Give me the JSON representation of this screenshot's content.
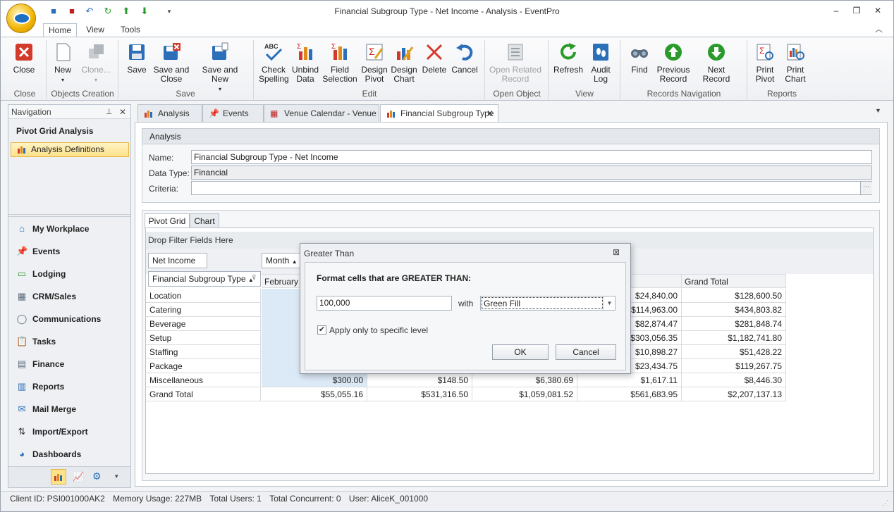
{
  "window": {
    "title": "Financial Subgroup Type - Net Income - Analysis - EventPro",
    "minimize_icon": "minimize-icon",
    "restore_icon": "restore-icon",
    "close_icon": "close-icon"
  },
  "ribbon_tabs": [
    "Home",
    "View",
    "Tools"
  ],
  "ribbon": {
    "close": "Close",
    "new": "New",
    "clone": "Clone...",
    "save": "Save",
    "save_close": "Save and\nClose",
    "save_new": "Save and New",
    "check_spelling": "Check\nSpelling",
    "unbind_data": "Unbind\nData",
    "field_selection": "Field\nSelection",
    "design_pivot": "Design\nPivot",
    "design_chart": "Design\nChart",
    "delete": "Delete",
    "cancel": "Cancel",
    "open_related_record": "Open Related\nRecord",
    "refresh": "Refresh",
    "audit_log": "Audit\nLog",
    "find": "Find",
    "previous_record": "Previous\nRecord",
    "next_record": "Next Record",
    "print_pivot": "Print\nPivot",
    "print_chart": "Print\nChart",
    "groups": {
      "close": "Close",
      "objects_creation": "Objects Creation",
      "save": "Save",
      "edit": "Edit",
      "open_object": "Open Object",
      "view": "View",
      "records_navigation": "Records Navigation",
      "reports": "Reports"
    }
  },
  "navigation": {
    "header": "Navigation",
    "title": "Pivot Grid Analysis",
    "selected_item": "Analysis Definitions",
    "items": [
      {
        "label": "My Workplace",
        "icon": "home-icon"
      },
      {
        "label": "Events",
        "icon": "pin-icon"
      },
      {
        "label": "Lodging",
        "icon": "bed-icon"
      },
      {
        "label": "CRM/Sales",
        "icon": "crm-icon"
      },
      {
        "label": "Communications",
        "icon": "speech-bubble-icon"
      },
      {
        "label": "Tasks",
        "icon": "clipboard-icon"
      },
      {
        "label": "Finance",
        "icon": "ledger-icon"
      },
      {
        "label": "Reports",
        "icon": "report-icon"
      },
      {
        "label": "Mail Merge",
        "icon": "mail-merge-icon"
      },
      {
        "label": "Import/Export",
        "icon": "import-export-icon"
      },
      {
        "label": "Dashboards",
        "icon": "dashboard-icon"
      }
    ]
  },
  "doc_tabs": [
    {
      "label": "Analysis",
      "icon": "pivot-icon"
    },
    {
      "label": "Events",
      "icon": "pin-icon"
    },
    {
      "label": "Venue Calendar - Venue",
      "icon": "calendar-icon"
    },
    {
      "label": "Financial Subgroup Type",
      "icon": "pivot-icon"
    }
  ],
  "analysis": {
    "header": "Analysis",
    "name_label": "Name:",
    "name_value": "Financial Subgroup Type - Net Income",
    "datatype_label": "Data Type:",
    "datatype_value": "Financial",
    "criteria_label": "Criteria:",
    "criteria_value": ""
  },
  "pivot": {
    "tabs": [
      "Pivot Grid",
      "Chart"
    ],
    "drop_filter": "Drop Filter Fields Here",
    "data_field": "Net Income",
    "column_field": "Month",
    "row_field": "Financial Subgroup Type",
    "column_header_first": "February",
    "grand_total_header": "Grand Total",
    "rows": [
      {
        "label": "Location",
        "c4": "$24,840.00",
        "total": "$128,600.50"
      },
      {
        "label": "Catering",
        "c4": "$114,963.00",
        "total": "$434,803.82"
      },
      {
        "label": "Beverage",
        "c4": "$82,874.47",
        "total": "$281,848.74"
      },
      {
        "label": "Setup",
        "c4": "$303,056.35",
        "total": "$1,182,741.80"
      },
      {
        "label": "Staffing",
        "c4": "$10,898.27",
        "total": "$51,428.22"
      },
      {
        "label": "Package",
        "c4": "$23,434.75",
        "total": "$119,267.75"
      },
      {
        "label": "Miscellaneous",
        "c1": "$300.00",
        "c2": "$148.50",
        "c3": "$6,380.69",
        "c4": "$1,617.11",
        "total": "$8,446.30"
      },
      {
        "label": "Grand Total",
        "c1": "$55,055.16",
        "c2": "$531,316.50",
        "c3": "$1,059,081.52",
        "c4": "$561,683.95",
        "total": "$2,207,137.13"
      }
    ]
  },
  "dialog": {
    "title": "Greater Than",
    "prompt": "Format cells that are GREATER THAN:",
    "value": "100,000",
    "with_label": "with",
    "format": "Green Fill",
    "checkbox_label": "Apply only to specific level",
    "checkbox_checked": true,
    "ok": "OK",
    "cancel": "Cancel"
  },
  "status": {
    "client_id": "Client ID: PSI001000AK2",
    "memory": "Memory Usage: 227MB",
    "total_users": "Total Users: 1",
    "total_concurrent": "Total Concurrent: 0",
    "user": "User: AliceK_001000"
  },
  "colors": {
    "accent_blue": "#2a6fb8",
    "selection_yellow": "#fde28a",
    "pivot_highlight": "#dce9f6"
  }
}
